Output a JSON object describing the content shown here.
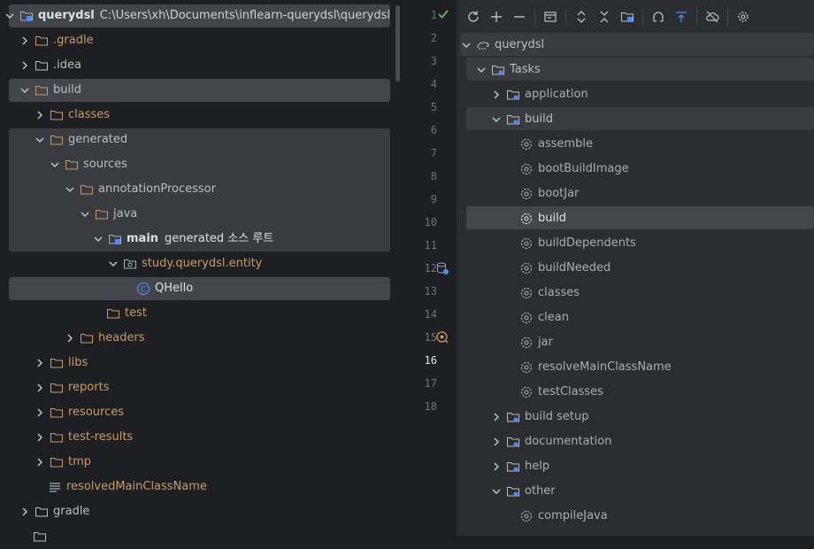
{
  "project_tree": {
    "root": {
      "name": "querydsl",
      "path": "C:\\Users\\xh\\Documents\\inflearn-querydsl\\querydsl"
    },
    "items": [
      {
        "label": "querydsl",
        "extra": "C:\\Users\\xh\\Documents\\inflearn-querydsl\\querydsl"
      },
      {
        "label": ".gradle"
      },
      {
        "label": ".idea"
      },
      {
        "label": "build"
      },
      {
        "label": "classes"
      },
      {
        "label": "generated"
      },
      {
        "label": "sources"
      },
      {
        "label": "annotationProcessor"
      },
      {
        "label": "java"
      },
      {
        "label": "main",
        "extra": "generated 소스 루트"
      },
      {
        "label": "study.querydsl.entity"
      },
      {
        "label": "QHello"
      },
      {
        "label": "test"
      },
      {
        "label": "headers"
      },
      {
        "label": "libs"
      },
      {
        "label": "reports"
      },
      {
        "label": "resources"
      },
      {
        "label": "test-results"
      },
      {
        "label": "tmp"
      },
      {
        "label": "resolvedMainClassName"
      },
      {
        "label": "gradle"
      }
    ]
  },
  "gutter": {
    "lines": [
      "1",
      "2",
      "3",
      "4",
      "5",
      "6",
      "7",
      "8",
      "9",
      "10",
      "11",
      "12",
      "13",
      "14",
      "15",
      "16",
      "17",
      "18"
    ],
    "current_line": "16"
  },
  "gradle_panel": {
    "toolbar": [
      "refresh-icon",
      "add-icon",
      "collapse-icon",
      "execute-task-icon",
      "expand-all-icon",
      "collapse-all-icon",
      "dependencies-icon",
      "link-icon",
      "show-ignored-icon",
      "offline-icon",
      "settings-icon"
    ],
    "items": [
      {
        "label": "querydsl"
      },
      {
        "label": "Tasks"
      },
      {
        "label": "application"
      },
      {
        "label": "build"
      },
      {
        "label": "assemble"
      },
      {
        "label": "bootBuildImage"
      },
      {
        "label": "bootJar"
      },
      {
        "label": "build"
      },
      {
        "label": "buildDependents"
      },
      {
        "label": "buildNeeded"
      },
      {
        "label": "classes"
      },
      {
        "label": "clean"
      },
      {
        "label": "jar"
      },
      {
        "label": "resolveMainClassName"
      },
      {
        "label": "testClasses"
      },
      {
        "label": "build setup"
      },
      {
        "label": "documentation"
      },
      {
        "label": "help"
      },
      {
        "label": "other"
      },
      {
        "label": "compileJava"
      }
    ]
  },
  "colors": {
    "background": "#1e1f22",
    "panel": "#2b2d30",
    "selection": "#43454a",
    "folder_orange": "#c99a68",
    "accent": "#548af7",
    "check_green": "#5fb865"
  }
}
